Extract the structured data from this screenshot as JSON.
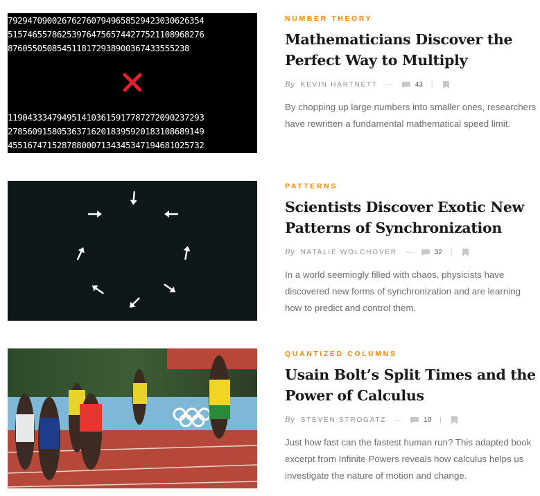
{
  "articles": [
    {
      "kicker": "NUMBER THEORY",
      "title_line1": "Mathematicians Discover the",
      "title_line2": "Perfect Way to Multiply",
      "by": "By",
      "author": "KEVIN HARTNETT",
      "comments": "43",
      "excerpt": "By chopping up large numbers into smaller ones, researchers have rewritten a fundamental mathematical speed limit.",
      "image": {
        "rows_top": [
          "7929470900267627607949658529423030626354",
          "5157465578625397647565744277521108968276",
          "8760550508545118172938900367433555238"
        ],
        "rows_bottom": [
          "1190433347949514103615917787272090237293",
          "2785609158053637162018395920183108689149",
          "4551674715287880007134345347194681025732"
        ]
      }
    },
    {
      "kicker": "PATTERNS",
      "title_line1": "Scientists Discover Exotic New",
      "title_line2": "Patterns of Synchronization",
      "by": "By",
      "author": "NATALIE WOLCHOVER",
      "comments": "32",
      "excerpt": "In a world seemingly filled with chaos, physicists have discovered new forms of synchronization and are learning how to predict and control them."
    },
    {
      "kicker": "QUANTIZED COLUMNS",
      "title_line1": "Usain Bolt’s Split Times and the",
      "title_line2": "Power of Calculus",
      "by": "By",
      "author": "STEVEN STROGATZ",
      "comments": "10",
      "excerpt": "Just how fast can the fastest human run? This adapted book excerpt from Infinite Powers reveals how calculus helps us investigate the nature of motion and change."
    }
  ],
  "colors": {
    "kicker": "#ff8600",
    "title": "#1a1a1a",
    "meta": "#9a9a9a",
    "excerpt": "#6b6b6b",
    "cross": "#e0202e",
    "dark_panel": "#0f1819"
  },
  "icons": {
    "comment": "comment-bubble-icon",
    "bookmark": "bookmark-icon",
    "cross": "cross-icon",
    "arrow": "arrow-icon"
  }
}
